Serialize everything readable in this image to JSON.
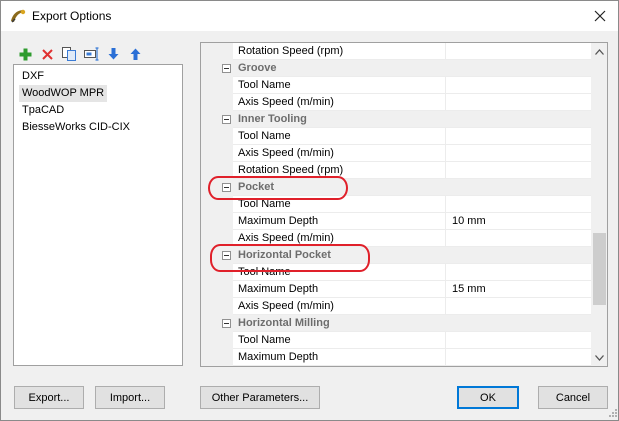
{
  "window": {
    "title": "Export Options",
    "close_glyph": "✕"
  },
  "toolbar": {
    "buttons": [
      {
        "icon": "add-icon",
        "color": "#2e9b2e"
      },
      {
        "icon": "delete-icon",
        "color": "#e03030"
      },
      {
        "icon": "copy-icon",
        "color": "#3a7bd5"
      },
      {
        "icon": "rename-icon",
        "color": "#3a7bd5"
      },
      {
        "icon": "move-down-icon",
        "color": "#2a6fd6"
      },
      {
        "icon": "move-up-icon",
        "color": "#2a6fd6"
      }
    ]
  },
  "profiles": {
    "items": [
      "DXF",
      "WoodWOP MPR",
      "TpaCAD",
      "BiesseWorks CID-CIX"
    ],
    "selected_index": 1
  },
  "properties": {
    "rows": [
      {
        "type": "prop",
        "name": "Rotation Speed (rpm)",
        "value": ""
      },
      {
        "type": "cat",
        "name": "Groove"
      },
      {
        "type": "prop",
        "name": "Tool Name",
        "value": ""
      },
      {
        "type": "prop",
        "name": "Axis Speed (m/min)",
        "value": ""
      },
      {
        "type": "cat",
        "name": "Inner Tooling"
      },
      {
        "type": "prop",
        "name": "Tool Name",
        "value": ""
      },
      {
        "type": "prop",
        "name": "Axis Speed (m/min)",
        "value": ""
      },
      {
        "type": "prop",
        "name": "Rotation Speed (rpm)",
        "value": ""
      },
      {
        "type": "cat",
        "name": "Pocket"
      },
      {
        "type": "prop",
        "name": "Tool Name",
        "value": ""
      },
      {
        "type": "prop",
        "name": "Maximum Depth",
        "value": "10 mm"
      },
      {
        "type": "prop",
        "name": "Axis Speed (m/min)",
        "value": ""
      },
      {
        "type": "cat",
        "name": "Horizontal Pocket"
      },
      {
        "type": "prop",
        "name": "Tool Name",
        "value": ""
      },
      {
        "type": "prop",
        "name": "Maximum Depth",
        "value": "15 mm"
      },
      {
        "type": "prop",
        "name": "Axis Speed (m/min)",
        "value": ""
      },
      {
        "type": "cat",
        "name": "Horizontal Milling"
      },
      {
        "type": "prop",
        "name": "Tool Name",
        "value": ""
      },
      {
        "type": "prop",
        "name": "Maximum Depth",
        "value": ""
      }
    ]
  },
  "buttons": {
    "export": "Export...",
    "import": "Import...",
    "other_parameters": "Other Parameters...",
    "ok": "OK",
    "cancel": "Cancel"
  },
  "annotations": {
    "highlight_color": "#e0202a",
    "highlighted_sections": [
      "Pocket",
      "Horizontal Pocket"
    ]
  }
}
